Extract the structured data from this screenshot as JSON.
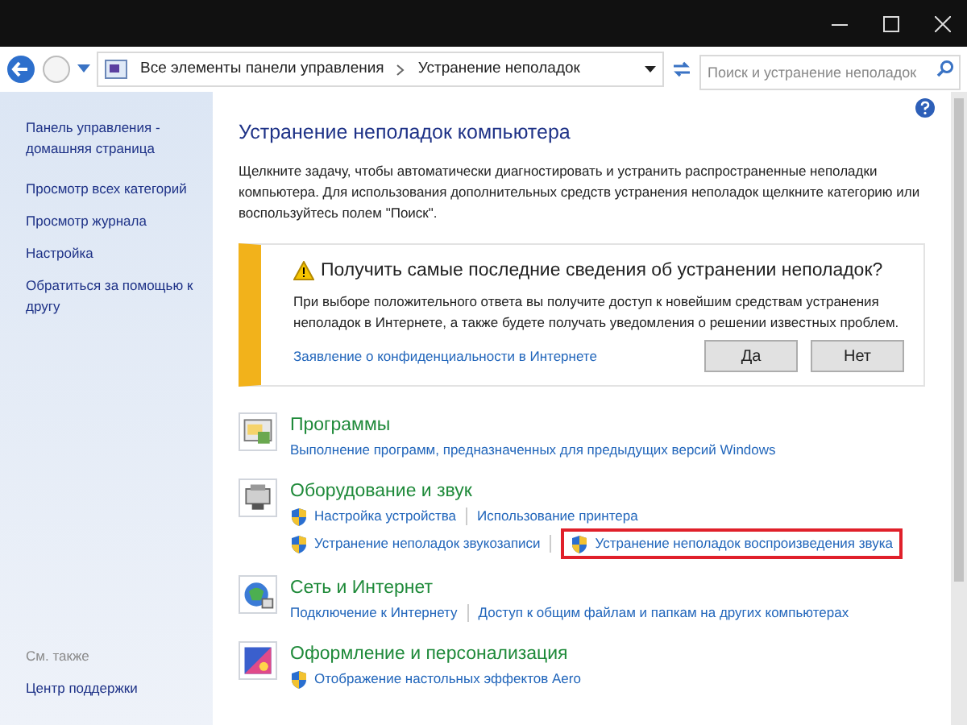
{
  "address_bar": {
    "breadcrumbs": [
      "Все элементы панели управления",
      "Устранение неполадок"
    ],
    "search": {
      "placeholder": "Поиск и устранение неполадок"
    }
  },
  "sidebar": {
    "links": [
      "Панель управления - домашняя страница",
      "Просмотр всех категорий",
      "Просмотр журнала",
      "Настройка",
      "Обратиться за помощью к другу"
    ],
    "see_also_label": "См. также",
    "see_also": [
      "Центр поддержки"
    ]
  },
  "heading": "Устранение неполадок компьютера",
  "intro": "Щелкните задачу, чтобы автоматически диагностировать и устранить распространенные неполадки компьютера. Для использования дополнительных средств устранения неполадок щелкните категорию или воспользуйтесь полем \"Поиск\".",
  "notice": {
    "title": "Получить самые последние сведения об устранении неполадок?",
    "text": "При выборе положительного ответа вы получите доступ к новейшим средствам устранения неполадок в Интернете, а также будете получать уведомления о решении известных проблем.",
    "link": "Заявление о конфиденциальности в Интернете",
    "buttons": [
      "Да",
      "Нет"
    ]
  },
  "categories": [
    {
      "kind": "programs",
      "title": "Программы",
      "rows": [
        [
          {
            "text": "Выполнение программ, предназначенных для предыдущих версий Windows",
            "shield": false,
            "highlighted": false
          }
        ]
      ]
    },
    {
      "kind": "hardware",
      "title": "Оборудование и звук",
      "rows": [
        [
          {
            "text": "Настройка устройства",
            "shield": true,
            "highlighted": false
          },
          {
            "text": "Использование принтера",
            "shield": false,
            "highlighted": false
          }
        ],
        [
          {
            "text": "Устранение неполадок звукозаписи",
            "shield": true,
            "highlighted": false
          },
          {
            "text": "Устранение неполадок воспроизведения звука",
            "shield": true,
            "highlighted": true
          }
        ]
      ]
    },
    {
      "kind": "network",
      "title": "Сеть и Интернет",
      "rows": [
        [
          {
            "text": "Подключение к Интернету",
            "shield": false,
            "highlighted": false
          },
          {
            "text": "Доступ к общим файлам и папкам на других компьютерах",
            "shield": false,
            "highlighted": false
          }
        ]
      ]
    },
    {
      "kind": "appearance",
      "title": "Оформление и персонализация",
      "rows": [
        [
          {
            "text": "Отображение настольных эффектов Aero",
            "shield": true,
            "highlighted": false
          }
        ]
      ]
    }
  ]
}
